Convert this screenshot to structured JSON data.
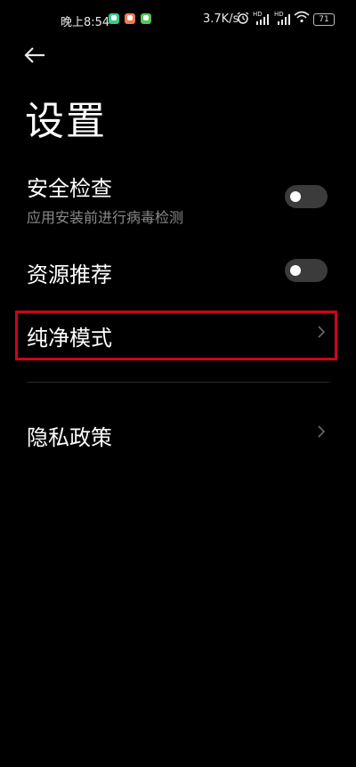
{
  "status_bar": {
    "time": "晚上8:54",
    "net_speed": "3.7K/s",
    "signal_tag": "HD",
    "battery": "71"
  },
  "header": {
    "title": "设置"
  },
  "items": {
    "security_check": {
      "label": "安全检查",
      "subtitle": "应用安装前进行病毒检测",
      "enabled": false
    },
    "resource_recommend": {
      "label": "资源推荐",
      "enabled": false
    },
    "pure_mode": {
      "label": "纯净模式"
    },
    "privacy_policy": {
      "label": "隐私政策"
    }
  },
  "colors": {
    "background": "#000000",
    "highlight": "#d0021b",
    "toggle_off": "#3b3b3b"
  },
  "icons": [
    "back-arrow-icon",
    "alarm-icon",
    "signal-icon",
    "wifi-icon",
    "battery-icon",
    "chevron-right-icon"
  ]
}
